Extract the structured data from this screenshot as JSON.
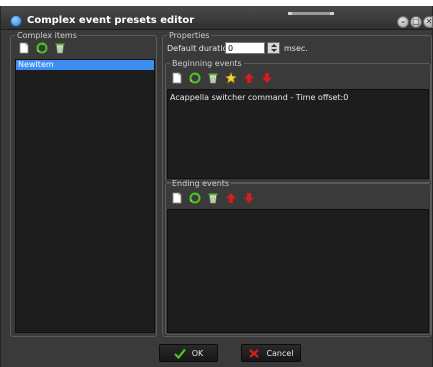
{
  "window": {
    "title": "Complex event presets editor"
  },
  "title_buttons": [
    {
      "name": "minimize",
      "glyph": "–"
    },
    {
      "name": "maximize",
      "glyph": "□"
    },
    {
      "name": "close",
      "glyph": "✕"
    }
  ],
  "complex_items": {
    "legend": "Complex items",
    "toolbar": [
      "new-document-icon",
      "recycle-icon",
      "delete-bin-icon"
    ],
    "items": [
      "NewItem"
    ],
    "selected_index": 0
  },
  "properties": {
    "legend": "Properties",
    "default_duration_label": "Default duratio",
    "default_duration_value": "0",
    "duration_unit": "msec."
  },
  "beginning_events": {
    "legend": "Beginning events",
    "toolbar": [
      "new-document-icon",
      "recycle-icon",
      "delete-bin-icon",
      "star-icon",
      "move-up-icon",
      "move-down-icon"
    ],
    "items": [
      "Acappella switcher command - Time offset:0"
    ]
  },
  "ending_events": {
    "legend": "Ending events",
    "toolbar": [
      "new-document-icon",
      "recycle-icon",
      "delete-bin-icon",
      "move-up-icon",
      "move-down-icon"
    ],
    "items": []
  },
  "footer": {
    "ok_label": "OK",
    "cancel_label": "Cancel"
  },
  "colors": {
    "window_bg": "#3a3a3a",
    "list_bg": "#1d1d1d",
    "selection": "#3d8ef0",
    "arrow_red": "#d81b1b",
    "ok_green": "#4fc21f"
  }
}
